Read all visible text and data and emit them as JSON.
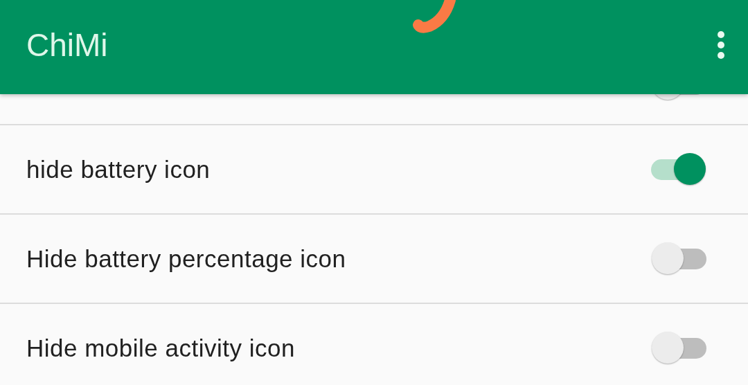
{
  "app_bar": {
    "title": "ChiMi"
  },
  "settings": [
    {
      "on": false
    },
    {
      "label": "hide battery icon",
      "on": true
    },
    {
      "label": "Hide battery percentage icon",
      "on": false
    },
    {
      "label": "Hide mobile activity icon",
      "on": false
    }
  ]
}
